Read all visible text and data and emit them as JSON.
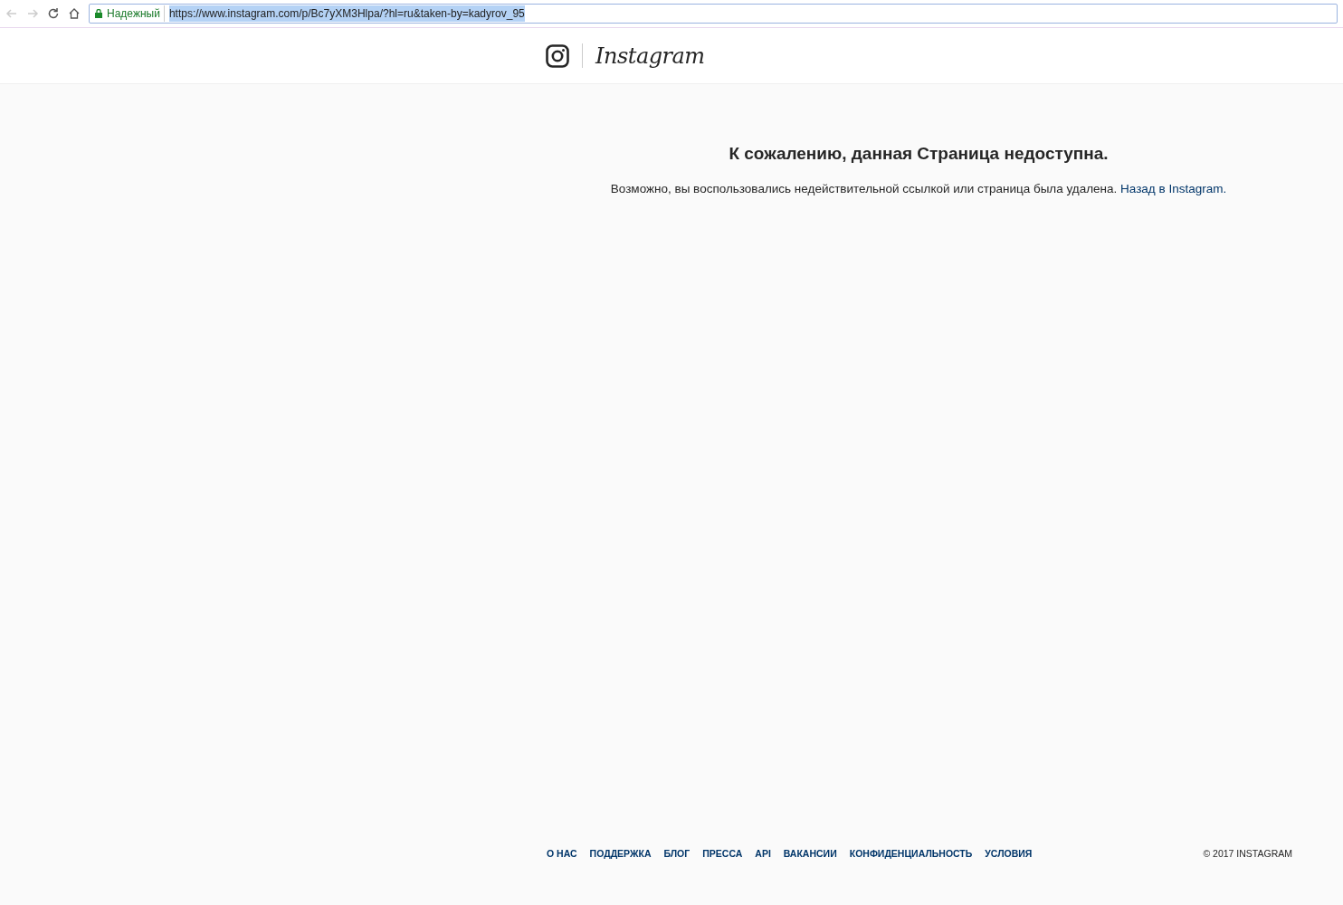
{
  "browser": {
    "security_label": "Надежный",
    "url": "https://www.instagram.com/p/Bc7yXM3Hlpa/?hl=ru&taken-by=kadyrov_95",
    "url_selected": true
  },
  "header": {
    "wordmark": "Instagram"
  },
  "error": {
    "title": "К сожалению, данная Страница недоступна.",
    "message": "Возможно, вы воспользовались недействительной ссылкой или страница была удалена.",
    "link": "Назад в Instagram."
  },
  "footer": {
    "links": [
      "О НАС",
      "ПОДДЕРЖКА",
      "БЛОГ",
      "ПРЕССА",
      "API",
      "ВАКАНСИИ",
      "КОНФИДЕНЦИАЛЬНОСТЬ",
      "УСЛОВИЯ"
    ],
    "copyright": "© 2017 INSTAGRAM"
  }
}
